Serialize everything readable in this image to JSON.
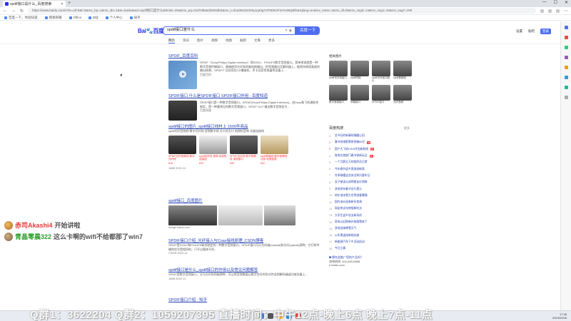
{
  "browser": {
    "tab_title": "spdif接口是什么_百度搜索",
    "new_tab": "+",
    "window_controls": [
      "—",
      "☐",
      "✕"
    ],
    "url": "https://www.baidu.com/s?ie=utf-8&f=8&rsv_bp=1&rsv_idx=1&tn=baidu&wd=spdif接口是什么&fenlei=256&rsv_pq=0xd7d8a6d3000db2&rsv_t=d1a2Bx3S3X5y1qKtg7cP9D6mF2e%2BQ8fK&rqlang=en&rsv_enter=1&rsv_dl=tb&rsv_sug3=14&rsv_sug1=10&rsv_sug7=100",
    "bookmarks": [
      "百度一下，你就知道",
      "网易邮箱",
      "Office",
      "B站",
      "个人中心",
      "知乎"
    ]
  },
  "baidu": {
    "logo_left": "Bai",
    "logo_paw": "du",
    "logo_right": "百度",
    "query": "spdif接口是什么",
    "search_button": "百度一下",
    "header_links": [
      "设置",
      "贴吧",
      "登录"
    ],
    "tabs": [
      "网页",
      "资讯",
      "图片",
      "视频",
      "地图",
      "贴吧",
      "文库",
      "更多"
    ]
  },
  "results": [
    {
      "title": "SPDIF_百度百科",
      "snippet": "SPDIF（Sony/Philips Digital Interface）即SONY、PHILIPS数字音频接口。简单地说就是一种数字音频传输接口，普遍使用光纤和同轴电缆输出，把音频输出至解码器上，能保持高保真度的输出结果。SPDIF广泛应用在CD播放机、声卡及家用电器等设备上...",
      "source": "百度百科"
    },
    {
      "title": "SPDIF接口 什么是SPDIF接口 SPDIF接口作用 - 百度知道",
      "snippet": "SPDIF接口是一种数字音频接口，SPDIF(Sony/Philips Digital Interface)，由Sony和飞利浦联合制定，是一种最常见的数字音频接口，SPDIF OUT 输出数字音频信号...",
      "source": "百度知道"
    },
    {
      "title": "spdif接口的图片_spdif接口线材上 1500件商品",
      "snippet": "spdif光纤音频线 数字光纤线 音频数字线 方口对方口 电视机音响 功放连接线",
      "captions": [
        "SPDIF光纤音频线 数字光纤线",
        "spdif光纤线 音响 功放机连接线",
        "SPDIF光纤线 数字音频线 电视接口",
        "spdif同轴线 数字音频线 功放 电视连接"
      ],
      "prices": [
        "¥15",
        "¥19",
        "¥26",
        "¥32"
      ],
      "source": "1688 2022-11"
    },
    {
      "title": "spdif接口_百度图片",
      "source": "image.baidu.com"
    },
    {
      "title": "SPDIF接口介绍_光纤接入与Coax接线原理_CSDN博客",
      "snippet": "SPDIF是SONY和PHILIPS联合制定的一种数字音频接口。SPDIF接口可分为同轴(coaxial)和光纤(optical)两种，它们所传输的信号是相同的，只不过载体不同...",
      "source": "CSDN 2022-11"
    },
    {
      "title": "spdif接口是什么_spdif接口的作用以及常见问题解答",
      "snippet": "SPDIF是数字音频接口，分为光纤和同轴两种，可以将音频数据以数字信号的形式传送到解码器或功放设备上...",
      "source": "1688 2022-11"
    },
    {
      "title": "SPDIF接口介绍 - 知乎"
    }
  ],
  "right_col": {
    "title": "相关图片",
    "more": "更多",
    "items": [
      "spdif光纤线接口",
      "spdif同轴",
      "spdif光纤接口图片",
      "spdif音频线",
      "数字音频接口",
      "同轴接口",
      "SPDIF接口",
      "光纤音频"
    ]
  },
  "hot": {
    "title": "百度热搜",
    "items": [
      {
        "n": "1",
        "text": "总书记的新春祝福暖心田",
        "tag": ""
      },
      {
        "n": "2",
        "text": "春节档电影票房突破60亿",
        "tag": "热"
      },
      {
        "n": "3",
        "text": "国产大飞机C919开启新航线",
        "tag": "新"
      },
      {
        "n": "4",
        "text": "各地文旅部门春节创新玩法",
        "tag": "热"
      },
      {
        "n": "5",
        "text": "一个月薪五万的程序员日常",
        "tag": ""
      },
      {
        "n": "6",
        "text": "今年春节返乡客流创新高",
        "tag": ""
      },
      {
        "n": "7",
        "text": "冬季取暖这些安全知识要牢记",
        "tag": ""
      },
      {
        "n": "8",
        "text": "女子被误认成明星走红网络",
        "tag": ""
      },
      {
        "n": "9",
        "text": "多地发布春节出行提示",
        "tag": ""
      },
      {
        "n": "10",
        "text": "哈尔滨冰雪大世界游客爆满",
        "tag": ""
      },
      {
        "n": "11",
        "text": "国内油价迎来新年首调",
        "tag": ""
      },
      {
        "n": "12",
        "text": "网友热议年夜饭新吃法",
        "tag": ""
      },
      {
        "n": "13",
        "text": "大学生返乡创业新风尚",
        "tag": ""
      },
      {
        "n": "14",
        "text": "家电以旧换新补贴政策来了",
        "tag": ""
      },
      {
        "n": "15",
        "text": "多地迎来降雪天气",
        "tag": ""
      },
      {
        "n": "16",
        "text": "火车票退改新规实施",
        "tag": ""
      },
      {
        "n": "17",
        "text": "新能源汽车下乡活动启动",
        "tag": ""
      },
      {
        "n": "18",
        "text": "今日立春",
        "tag": ""
      }
    ]
  },
  "ad": {
    "line1": "▶想在此推广您的产品吗？",
    "line2": "咨询热线: 400-800-8888",
    "line3": "e.baidu.com"
  },
  "chat": [
    {
      "user": "赤司Akashi4",
      "message": "开始讲啦"
    },
    {
      "user": "青晶零晨322",
      "message": "这么卡啊的wifi不给都那了win7"
    }
  ],
  "overlay": {
    "text": "Q群1：3622204    Q群2：1059207395    直播时间：中午12点-晚上6点 晚上7点-11点"
  },
  "taskbar": {
    "time": "17:38",
    "date": "2023/02/06"
  }
}
